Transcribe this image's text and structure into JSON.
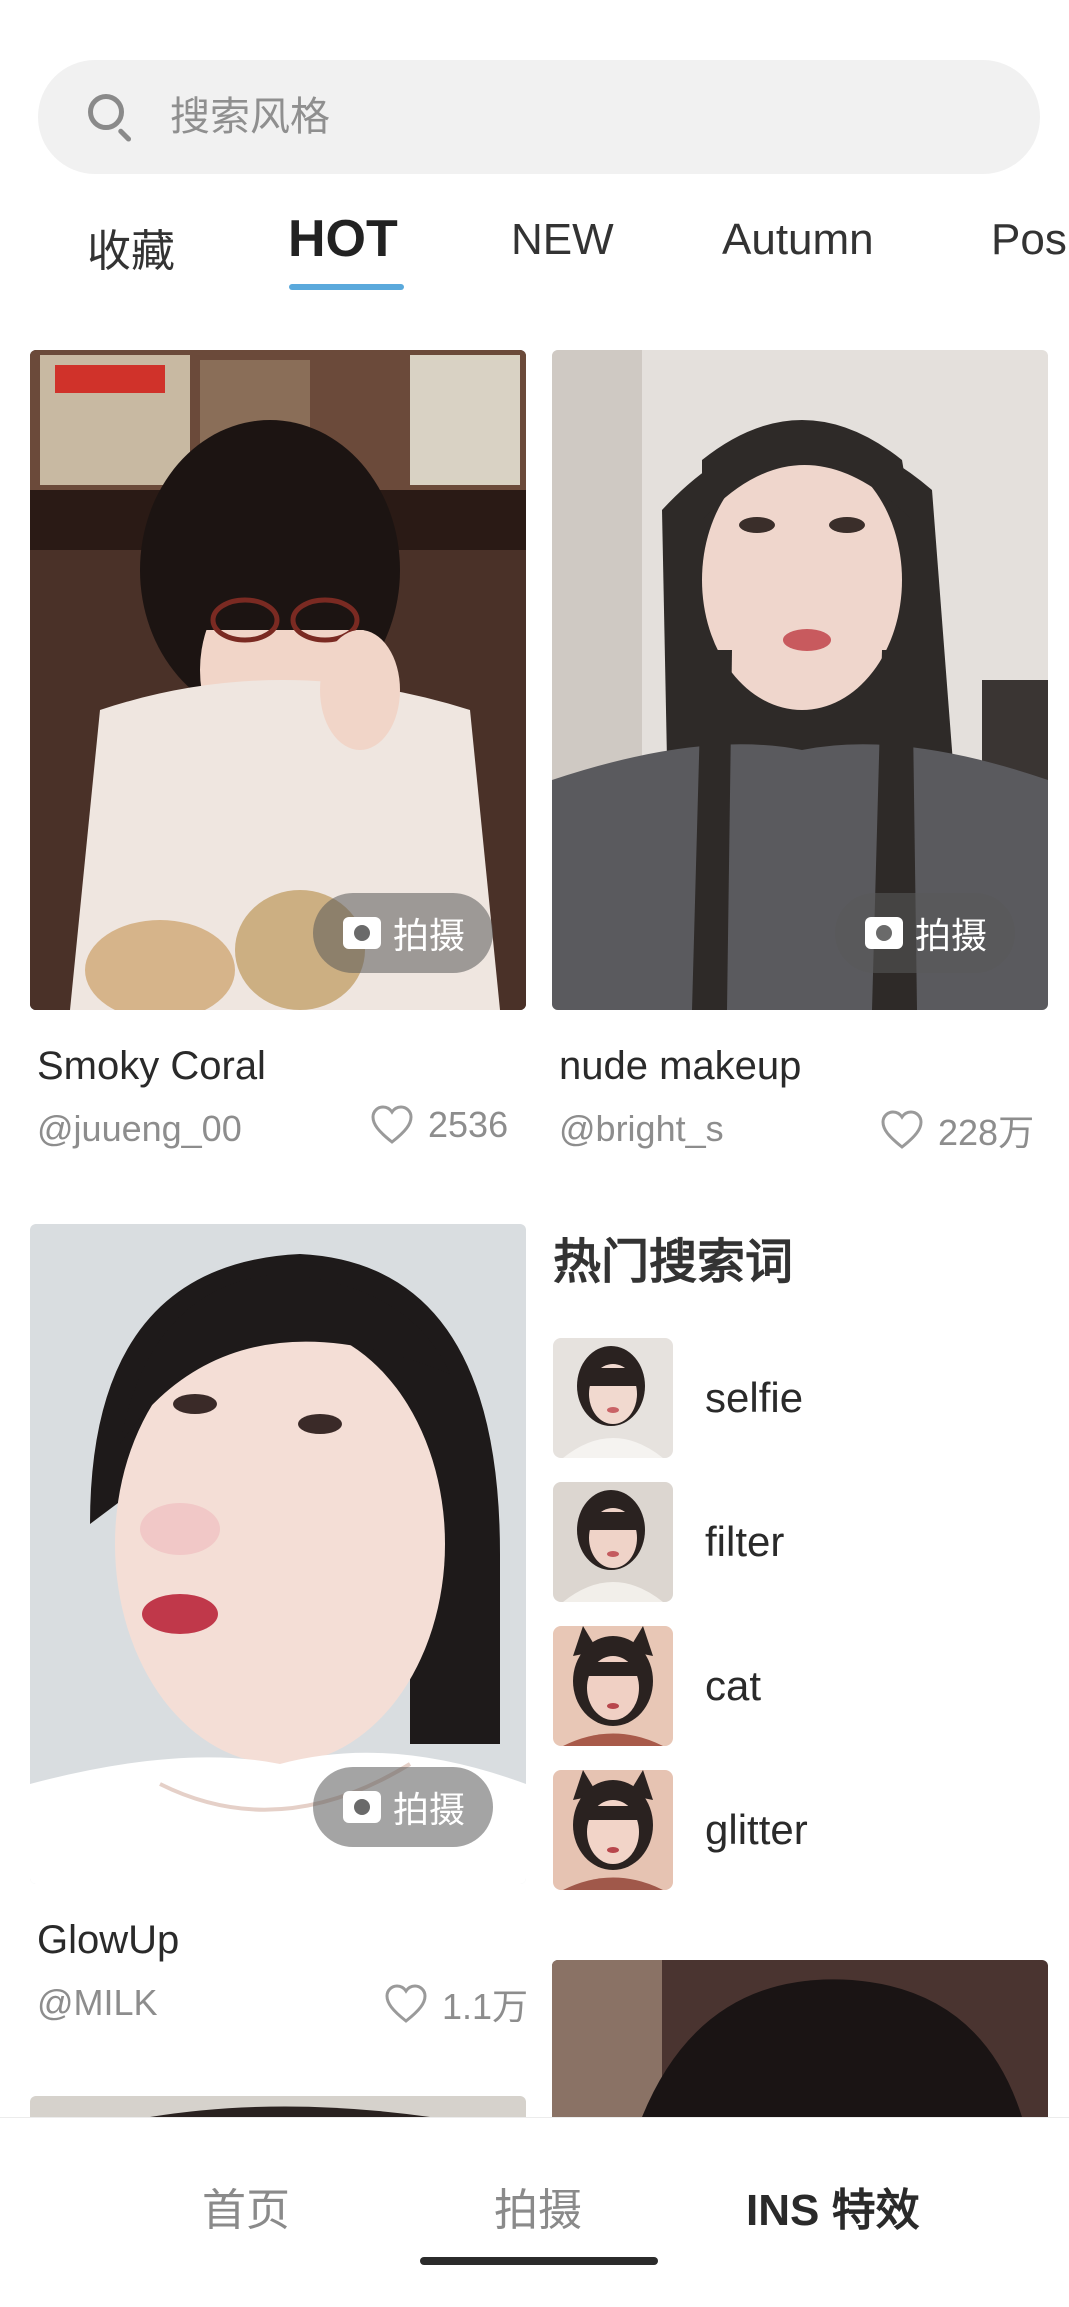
{
  "search": {
    "placeholder": "搜索风格"
  },
  "tabs": [
    {
      "label": "收藏"
    },
    {
      "label": "HOT"
    },
    {
      "label": "NEW"
    },
    {
      "label": "Autumn"
    },
    {
      "label": "Pos"
    }
  ],
  "active_tab": "HOT",
  "cards": [
    {
      "title": "Smoky Coral",
      "author": "@juueng_00",
      "likes": "2536",
      "shoot_label": "拍摄"
    },
    {
      "title": "nude makeup",
      "author": "@bright_s",
      "likes": "228万",
      "shoot_label": "拍摄"
    },
    {
      "title": "GlowUp",
      "author": "@MILK",
      "likes": "1.1万",
      "shoot_label": "拍摄"
    }
  ],
  "hot_search": {
    "title": "热门搜索词",
    "items": [
      {
        "label": "selfie"
      },
      {
        "label": "filter"
      },
      {
        "label": "cat"
      },
      {
        "label": "glitter"
      }
    ]
  },
  "bottom_nav": [
    {
      "label": "首页"
    },
    {
      "label": "拍摄"
    },
    {
      "label": "INS 特效"
    }
  ],
  "active_nav": "INS 特效",
  "colors": {
    "accent": "#5aa9dc",
    "search_bg": "#f1f1f1",
    "muted_text": "#8d8d8d"
  }
}
